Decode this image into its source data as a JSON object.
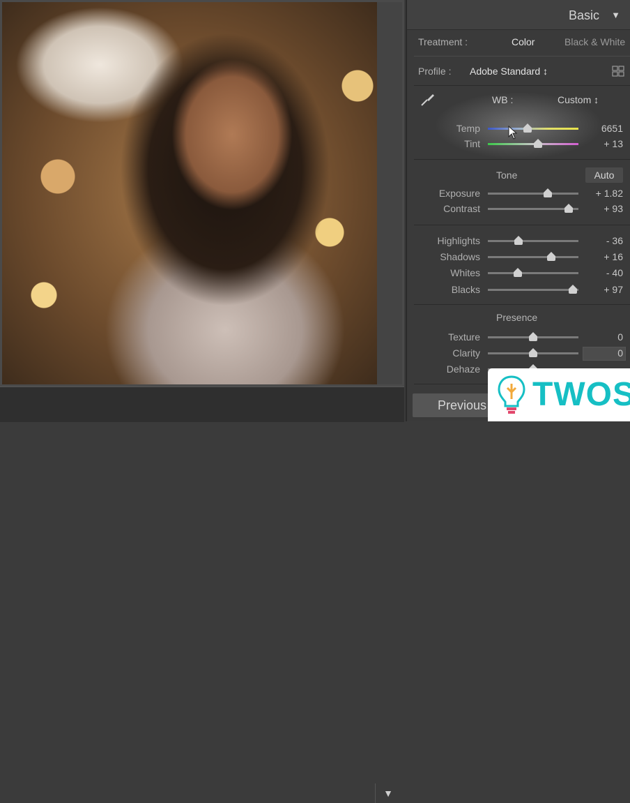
{
  "panel": {
    "title": "Basic",
    "collapse_icon": "triangle-down-icon"
  },
  "treatment": {
    "label": "Treatment :",
    "options": [
      "Color",
      "Black & White"
    ],
    "selected": "Color"
  },
  "profile": {
    "label": "Profile :",
    "value": "Adobe Standard ↕"
  },
  "wb": {
    "label": "WB :",
    "value": "Custom ↕",
    "temp": {
      "label": "Temp",
      "value": "6651",
      "position": 0.44
    },
    "tint": {
      "label": "Tint",
      "value": "+ 13",
      "position": 0.55
    }
  },
  "tone": {
    "title": "Tone",
    "auto_label": "Auto",
    "sliders": [
      {
        "label": "Exposure",
        "value": "+ 1.82",
        "position": 0.66
      },
      {
        "label": "Contrast",
        "value": "+ 93",
        "position": 0.89
      }
    ]
  },
  "tone2": {
    "sliders": [
      {
        "label": "Highlights",
        "value": "- 36",
        "position": 0.34
      },
      {
        "label": "Shadows",
        "value": "+ 16",
        "position": 0.7
      },
      {
        "label": "Whites",
        "value": "- 40",
        "position": 0.33
      },
      {
        "label": "Blacks",
        "value": "+ 97",
        "position": 0.94
      }
    ]
  },
  "presence": {
    "title": "Presence",
    "sliders": [
      {
        "label": "Texture",
        "value": "0",
        "position": 0.5
      },
      {
        "label": "Clarity",
        "value": "0",
        "position": 0.5
      },
      {
        "label": "Dehaze",
        "value": "",
        "position": 0.5
      }
    ]
  },
  "footer": {
    "previous_label": "Previous",
    "filmstrip_icon": "triangle-down-icon"
  },
  "watermark": {
    "text": "TWOS"
  }
}
